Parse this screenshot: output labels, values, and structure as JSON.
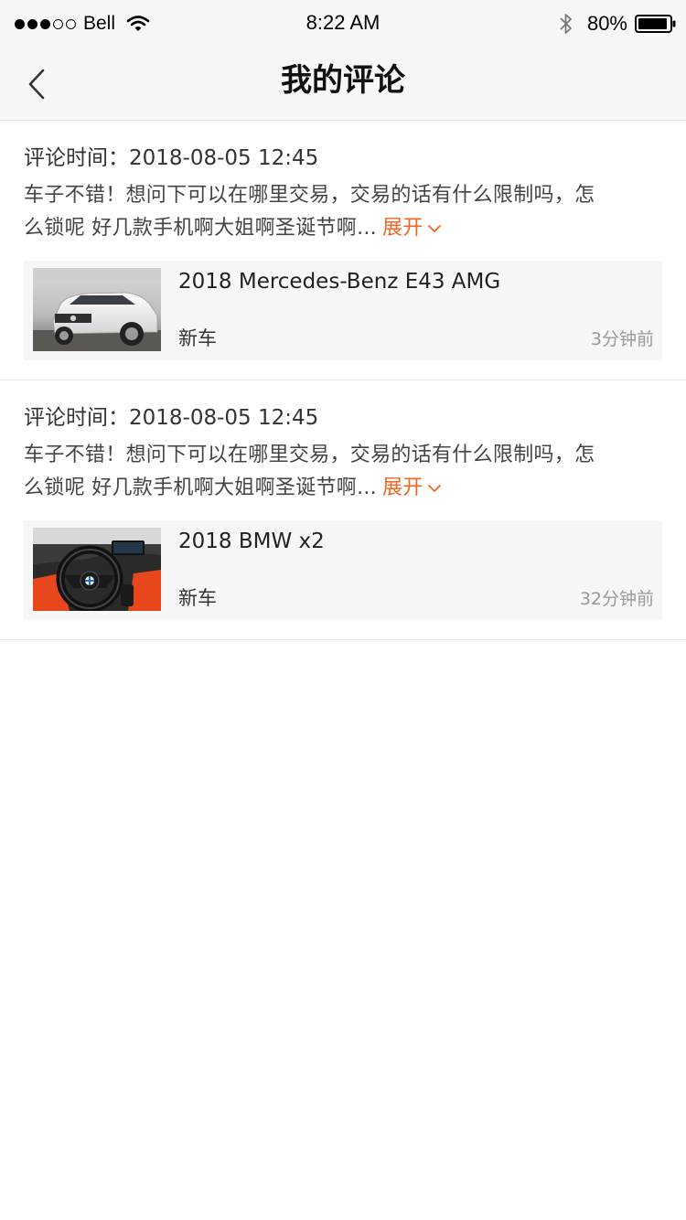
{
  "status_bar": {
    "carrier": "Bell",
    "time": "8:22 AM",
    "battery": "80%"
  },
  "nav": {
    "title": "我的评论"
  },
  "colors": {
    "accent": "#f26522",
    "nav_bg": "#f7f7f7",
    "card_bg": "#f7f7f7",
    "muted_text": "#999999"
  },
  "comments": [
    {
      "time": "评论时间：2018-08-05 12:45",
      "text_line1": "车子不错！想问下可以在哪里交易，交易的话有什么限制吗，怎",
      "text_line2": "么锁呢 好几款手机啊大姐啊圣诞节啊...",
      "expand_label": "展开",
      "car": {
        "name": "2018 Mercedes-Benz E43 AMG",
        "tag": "新车",
        "ago": "3分钟前"
      }
    },
    {
      "time": "评论时间：2018-08-05 12:45",
      "text_line1": "车子不错！想问下可以在哪里交易，交易的话有什么限制吗，怎",
      "text_line2": "么锁呢 好几款手机啊大姐啊圣诞节啊...",
      "expand_label": "展开",
      "car": {
        "name": "2018 BMW x2",
        "tag": "新车",
        "ago": "32分钟前"
      }
    }
  ],
  "icons": [
    "back-chevron-icon",
    "chevron-down-icon",
    "wifi-icon",
    "bluetooth-icon",
    "battery-icon"
  ]
}
